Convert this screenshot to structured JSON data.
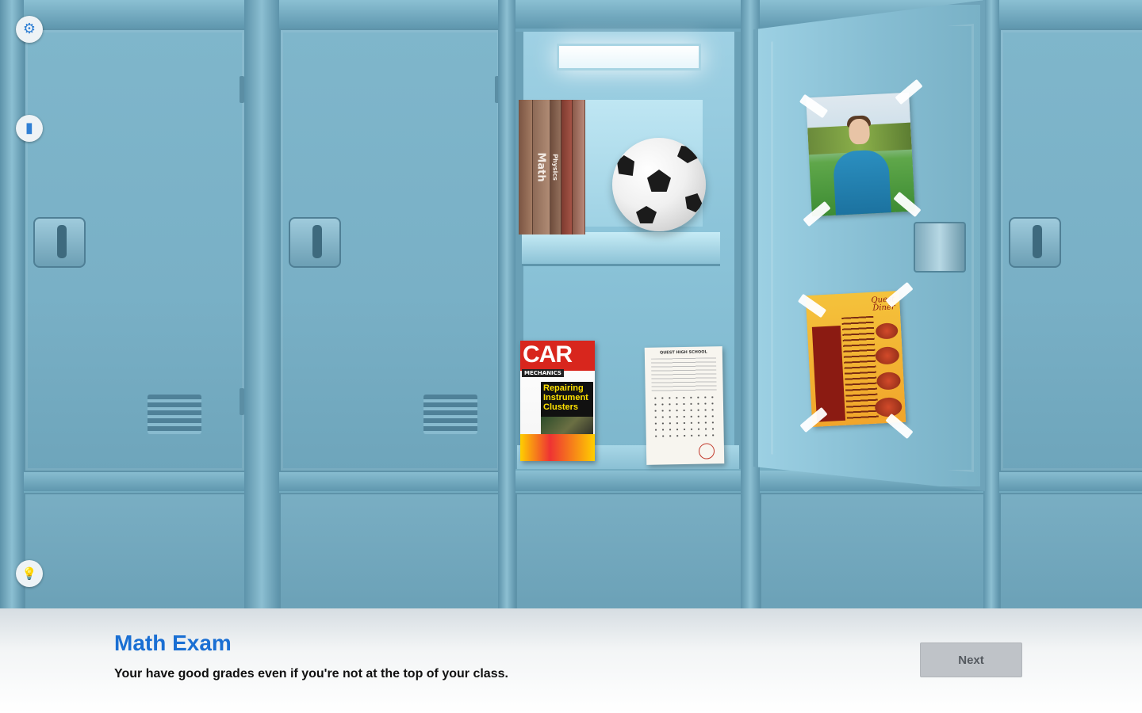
{
  "sidebar": {
    "buttons": [
      {
        "name": "settings",
        "icon": "gear-icon",
        "glyph": "⚙"
      },
      {
        "name": "clipboard",
        "icon": "clipboard-icon",
        "glyph": "▮"
      },
      {
        "name": "hint",
        "icon": "lightbulb-icon",
        "glyph": "💡"
      }
    ]
  },
  "locker": {
    "books": [
      "Math",
      "Physics"
    ],
    "magazine": {
      "title": "CAR",
      "subtitle": "MECHANICS",
      "headline": "Repairing Instrument Clusters"
    },
    "exam": {
      "school": "QUEST HIGH SCHOOL"
    },
    "menu": {
      "title_line1": "Quest",
      "title_line2": "Diner"
    }
  },
  "dialog": {
    "title": "Math Exam",
    "message": "Your have good grades even if you're not at the top of your class.",
    "next_label": "Next"
  },
  "colors": {
    "title": "#1a6fd3",
    "next_button": "#bfc3c8",
    "locker": "#7fb6cb"
  }
}
